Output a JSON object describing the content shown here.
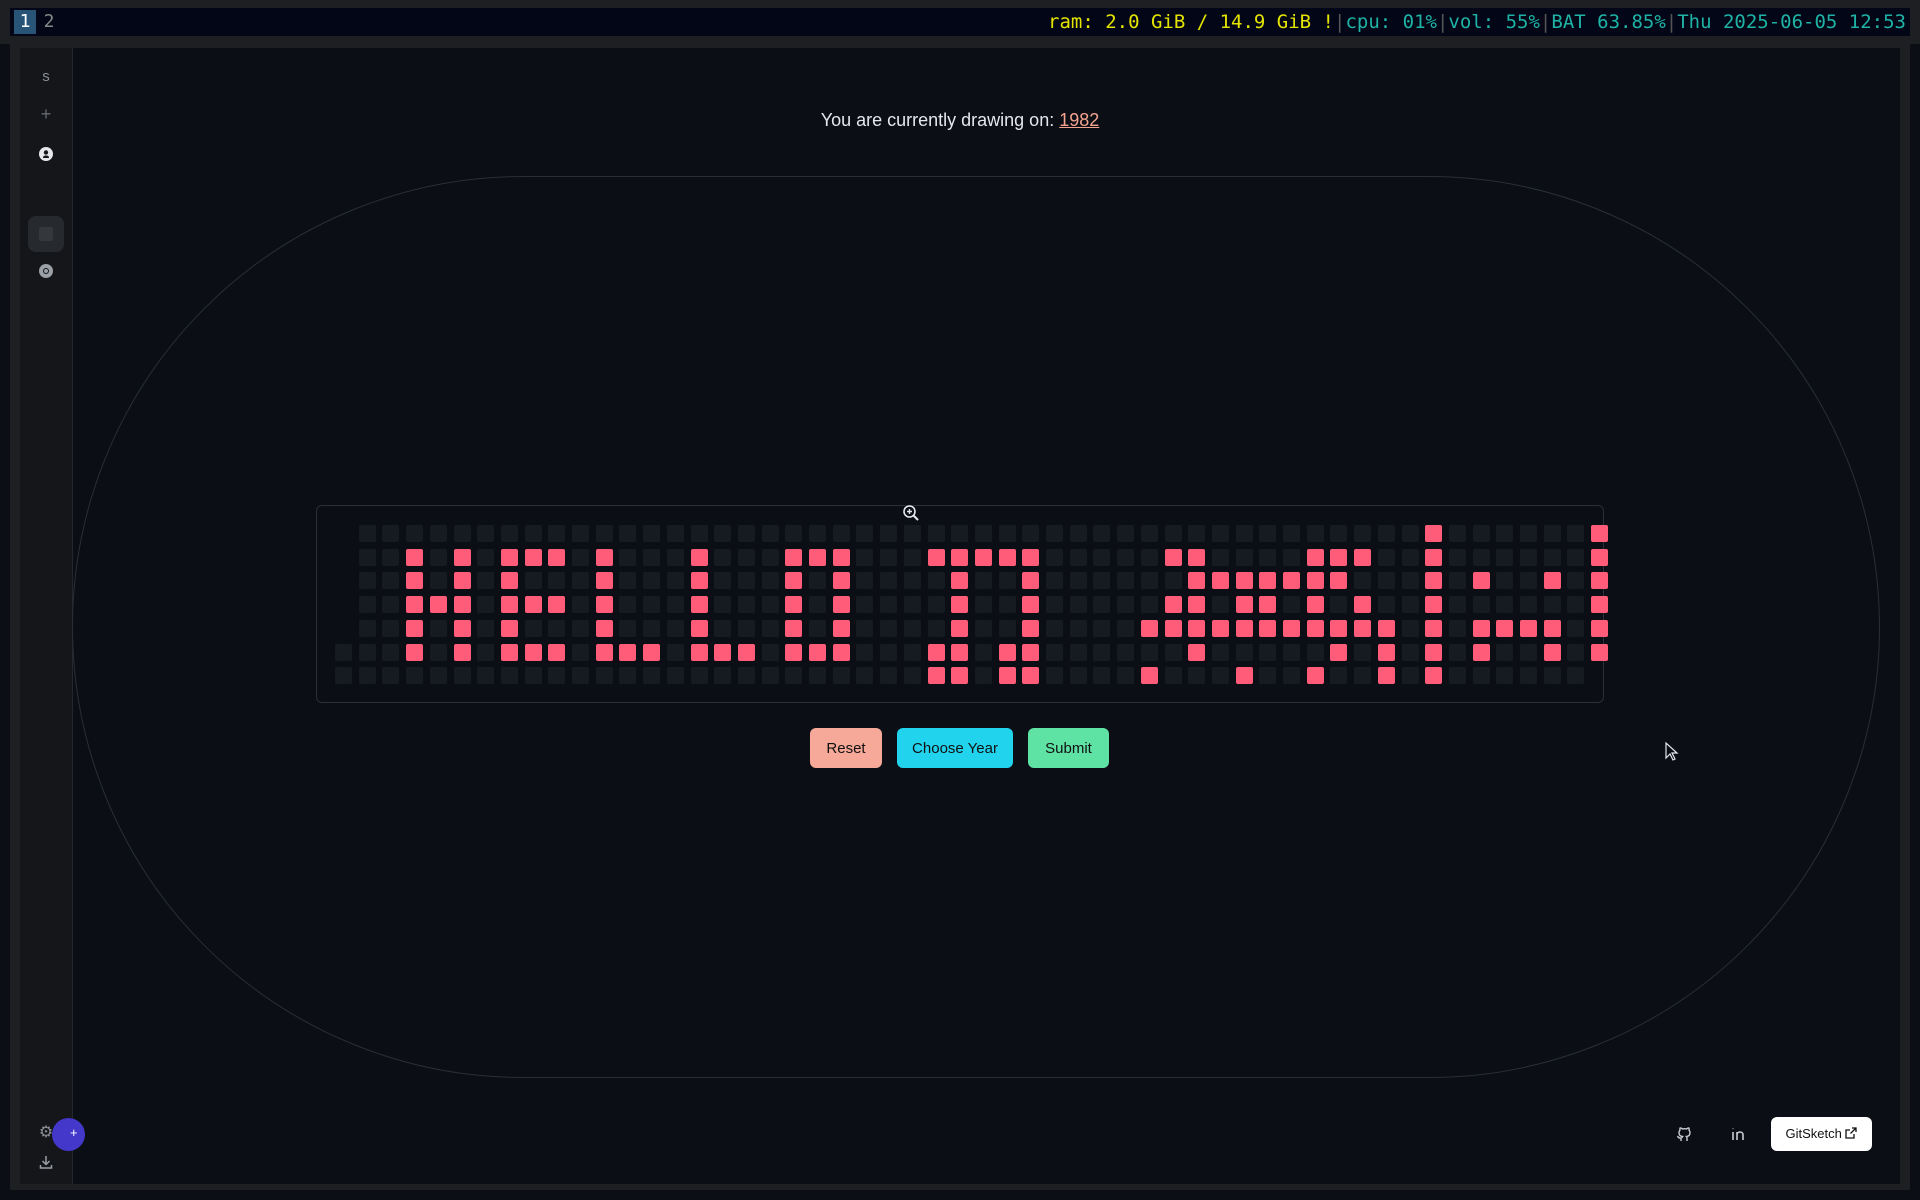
{
  "statusbar": {
    "workspaces": [
      "1",
      "2"
    ],
    "ram": "ram: 2.0 GiB / 14.9 GiB !",
    "cpu": "cpu: 01%",
    "vol": "vol: 55%",
    "battery": "BAT 63.85%",
    "datetime": "Thu 2025-06-05 12:53"
  },
  "sidebar": {
    "letter": "s",
    "plus": "+",
    "icons": [
      "github-icon",
      "workspace-icon",
      "chrome-icon",
      "settings-icon",
      "download-icon"
    ]
  },
  "headline": {
    "prefix": "You are currently drawing on: ",
    "year": "1982"
  },
  "grid": {
    "columns": 53,
    "rows": 7,
    "first_week_start_row": 5,
    "last_week_end_row": 5,
    "colors": {
      "empty": "#161b22",
      "filled": "#ff5c7a"
    },
    "filled": [
      [
        3,
        1
      ],
      [
        3,
        2
      ],
      [
        3,
        3
      ],
      [
        3,
        4
      ],
      [
        3,
        5
      ],
      [
        4,
        3
      ],
      [
        5,
        1
      ],
      [
        5,
        2
      ],
      [
        5,
        3
      ],
      [
        5,
        4
      ],
      [
        5,
        5
      ],
      [
        7,
        1
      ],
      [
        7,
        2
      ],
      [
        7,
        3
      ],
      [
        7,
        4
      ],
      [
        7,
        5
      ],
      [
        8,
        1
      ],
      [
        8,
        3
      ],
      [
        8,
        5
      ],
      [
        9,
        1
      ],
      [
        9,
        3
      ],
      [
        9,
        5
      ],
      [
        11,
        1
      ],
      [
        11,
        2
      ],
      [
        11,
        3
      ],
      [
        11,
        4
      ],
      [
        11,
        5
      ],
      [
        12,
        5
      ],
      [
        13,
        5
      ],
      [
        15,
        1
      ],
      [
        15,
        2
      ],
      [
        15,
        3
      ],
      [
        15,
        4
      ],
      [
        15,
        5
      ],
      [
        16,
        5
      ],
      [
        17,
        5
      ],
      [
        19,
        1
      ],
      [
        19,
        2
      ],
      [
        19,
        3
      ],
      [
        19,
        4
      ],
      [
        19,
        5
      ],
      [
        20,
        1
      ],
      [
        20,
        5
      ],
      [
        21,
        1
      ],
      [
        21,
        2
      ],
      [
        21,
        3
      ],
      [
        21,
        4
      ],
      [
        21,
        5
      ],
      [
        25,
        1
      ],
      [
        25,
        5
      ],
      [
        25,
        6
      ],
      [
        26,
        1
      ],
      [
        26,
        2
      ],
      [
        26,
        3
      ],
      [
        26,
        4
      ],
      [
        26,
        5
      ],
      [
        26,
        6
      ],
      [
        27,
        1
      ],
      [
        28,
        1
      ],
      [
        28,
        5
      ],
      [
        28,
        6
      ],
      [
        29,
        1
      ],
      [
        29,
        2
      ],
      [
        29,
        3
      ],
      [
        29,
        4
      ],
      [
        29,
        5
      ],
      [
        29,
        6
      ],
      [
        34,
        4
      ],
      [
        34,
        6
      ],
      [
        35,
        1
      ],
      [
        35,
        3
      ],
      [
        35,
        4
      ],
      [
        36,
        1
      ],
      [
        36,
        2
      ],
      [
        36,
        3
      ],
      [
        36,
        4
      ],
      [
        36,
        5
      ],
      [
        37,
        2
      ],
      [
        37,
        4
      ],
      [
        38,
        2
      ],
      [
        38,
        3
      ],
      [
        38,
        4
      ],
      [
        38,
        6
      ],
      [
        39,
        2
      ],
      [
        39,
        3
      ],
      [
        39,
        4
      ],
      [
        40,
        2
      ],
      [
        40,
        4
      ],
      [
        41,
        1
      ],
      [
        41,
        2
      ],
      [
        41,
        3
      ],
      [
        41,
        4
      ],
      [
        41,
        6
      ],
      [
        42,
        1
      ],
      [
        42,
        2
      ],
      [
        42,
        4
      ],
      [
        42,
        5
      ],
      [
        43,
        1
      ],
      [
        43,
        3
      ],
      [
        43,
        4
      ],
      [
        44,
        4
      ],
      [
        44,
        5
      ],
      [
        44,
        6
      ],
      [
        46,
        0
      ],
      [
        46,
        1
      ],
      [
        46,
        2
      ],
      [
        46,
        3
      ],
      [
        46,
        4
      ],
      [
        46,
        5
      ],
      [
        46,
        6
      ],
      [
        48,
        2
      ],
      [
        48,
        4
      ],
      [
        48,
        5
      ],
      [
        49,
        4
      ],
      [
        50,
        4
      ],
      [
        51,
        2
      ],
      [
        51,
        4
      ],
      [
        51,
        5
      ],
      [
        53,
        0
      ],
      [
        53,
        1
      ],
      [
        53,
        2
      ],
      [
        53,
        3
      ],
      [
        53,
        4
      ],
      [
        53,
        5
      ]
    ]
  },
  "buttons": {
    "reset": "Reset",
    "choose_year": "Choose Year",
    "submit": "Submit"
  },
  "footer": {
    "link_label": "GitSketch",
    "icons": [
      "github-icon",
      "linkedin-icon",
      "external-link-icon"
    ]
  }
}
